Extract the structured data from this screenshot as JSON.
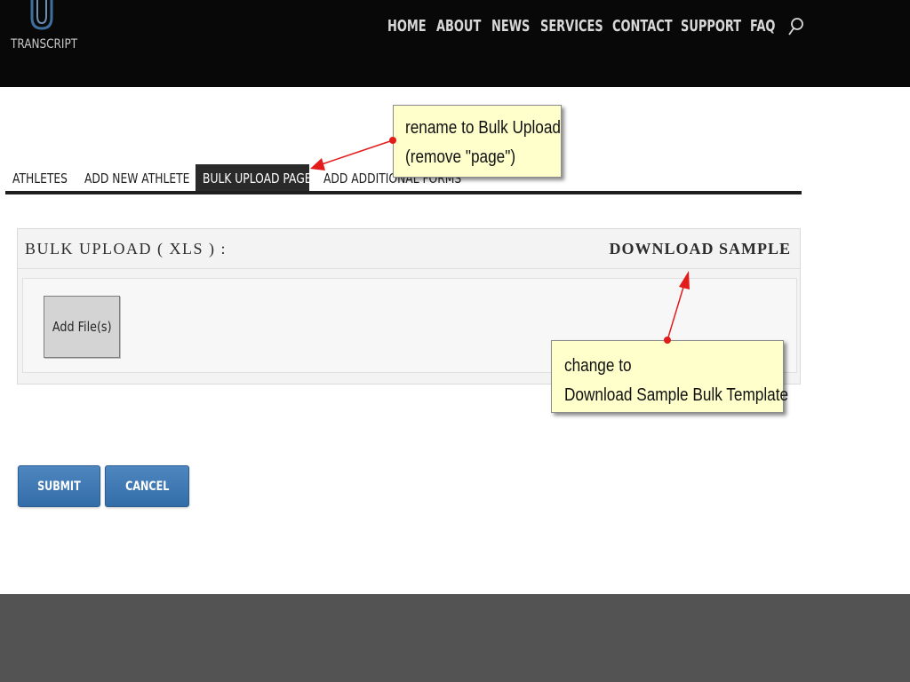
{
  "header": {
    "logo_text": "TRANSCRIPT",
    "nav": [
      "HOME",
      "ABOUT",
      "NEWS",
      "SERVICES",
      "CONTACT",
      "SUPPORT",
      "FAQ"
    ],
    "search_icon": "search-icon"
  },
  "tabs": {
    "items": [
      "ATHLETES",
      "ADD NEW ATHLETE",
      "BULK UPLOAD PAGE",
      "ADD ADDITIONAL FORMS"
    ],
    "active": "BULK UPLOAD PAGE"
  },
  "upload_panel": {
    "title": "BULK UPLOAD ( XLS ) :",
    "download_label": "DOWNLOAD SAMPLE",
    "add_file_label": "Add File(s)"
  },
  "form_actions": {
    "submit_label": "SUBMIT",
    "cancel_label": "CANCEL"
  },
  "annotations": [
    {
      "lines": [
        "rename to Bulk Upload",
        "(remove \"page\")"
      ]
    },
    {
      "lines": [
        "change to",
        "Download Sample Bulk Template"
      ]
    }
  ],
  "colors": {
    "header_bg": "#080808",
    "footer_bg": "#535353",
    "button_blue": "#3f78b4",
    "note_bg": "#ffffcc",
    "arrow_red": "#e21b1b"
  }
}
